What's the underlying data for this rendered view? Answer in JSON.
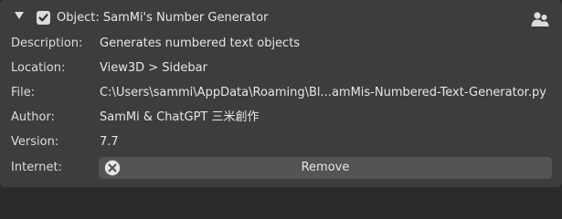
{
  "header": {
    "title": "Object: SamMi's Number Generator",
    "icons": {
      "collapse": "chevron-down-icon",
      "enabled": "checkbox-checked-icon",
      "users": "users-icon"
    }
  },
  "fields": {
    "description": {
      "label": "Description:",
      "value": "Generates numbered text objects"
    },
    "location": {
      "label": "Location:",
      "value": "View3D > Sidebar"
    },
    "file": {
      "label": "File:",
      "value": "C:\\Users\\sammi\\AppData\\Roaming\\Bl...amMis-Numbered-Text-Generator.py"
    },
    "author": {
      "label": "Author:",
      "value": "SamMi & ChatGPT 三米創作"
    },
    "version": {
      "label": "Version:",
      "value": "7.7"
    },
    "internet": {
      "label": "Internet:"
    }
  },
  "remove_button": {
    "label": "Remove",
    "icon": "close-circle-icon"
  },
  "colors": {
    "panel_bg": "#3d3d3d",
    "page_bg": "#2b2b2b",
    "button_bg": "#545454",
    "text": "#dcdcdc",
    "checkbox": "#dcdcdc"
  }
}
